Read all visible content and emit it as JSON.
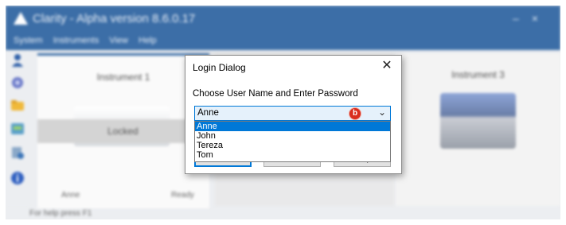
{
  "app": {
    "title": "Clarity - Alpha version 8.6.0.17",
    "menu": [
      "System",
      "Instruments",
      "View",
      "Help"
    ],
    "sidebar_icons": [
      "user-icon",
      "globe-icon",
      "folder-icon",
      "instrument-config-icon",
      "queue-icon",
      "info-icon"
    ],
    "panels": [
      {
        "title": "Instrument 1",
        "state": "Locked",
        "user": "Anne",
        "status": "Ready"
      },
      {
        "title": "Instrument 3"
      }
    ],
    "statusbar": "For help press F1"
  },
  "dialog": {
    "title": "Login Dialog",
    "prompt": "Choose User Name and Enter Password",
    "selected_user": "Anne",
    "options": [
      "Anne",
      "John",
      "Tereza",
      "Tom"
    ],
    "highlighted_option": "Anne",
    "callout": "b",
    "buttons": {
      "ok": "OK",
      "cancel": "Cancel",
      "help": "Help"
    }
  },
  "colors": {
    "accent": "#0078d7",
    "title_bar": "#3c6ea7",
    "callout": "#d92e1e"
  }
}
